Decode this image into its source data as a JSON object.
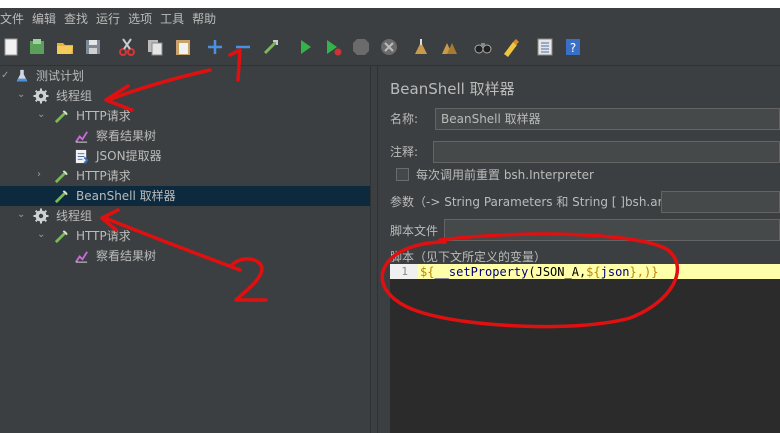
{
  "menu": [
    "文件",
    "编辑",
    "查找",
    "运行",
    "选项",
    "工具",
    "帮助"
  ],
  "toolbar": {
    "icons": [
      "new-icon",
      "templates-icon",
      "open-icon",
      "save-icon",
      "cut-icon",
      "copy-icon",
      "paste-icon",
      "expand-icon",
      "collapse-icon",
      "toggle-icon",
      "start-icon",
      "start-no-pause-icon",
      "stop-icon",
      "shutdown-icon",
      "clear-icon",
      "clear-all-icon",
      "search-icon",
      "reset-search-icon",
      "function-helper-icon",
      "help-icon"
    ]
  },
  "tree": {
    "items": [
      {
        "label": "测试计划",
        "icon": "test-plan-icon"
      },
      {
        "label": "线程组",
        "icon": "thread-group-icon"
      },
      {
        "label": "HTTP请求",
        "icon": "sampler-icon"
      },
      {
        "label": "察看结果树",
        "icon": "listener-icon"
      },
      {
        "label": "JSON提取器",
        "icon": "extractor-icon"
      },
      {
        "label": "HTTP请求",
        "icon": "sampler-icon"
      },
      {
        "label": "BeanShell 取样器",
        "icon": "sampler-icon"
      },
      {
        "label": "线程组",
        "icon": "thread-group-icon"
      },
      {
        "label": "HTTP请求",
        "icon": "sampler-icon"
      },
      {
        "label": "察看结果树",
        "icon": "listener-icon"
      }
    ]
  },
  "panel": {
    "title": "BeanShell 取样器",
    "name_label": "名称:",
    "name_value": "BeanShell 取样器",
    "comment_label": "注释:",
    "comment_value": "",
    "reset_checkbox_label": "每次调用前重置 bsh.Interpreter",
    "reset_checked": false,
    "params_label": "参数（-> String Parameters 和 String [ ]bsh.args）",
    "script_file_label": "脚本文件",
    "script_label": "脚本（见下文所定义的变量）",
    "line_number": "1",
    "code_parts": {
      "p1": "${",
      "p2": "__setProperty",
      "p3": "(JSON_A,",
      "p4": "${",
      "p5": "json",
      "p6": "},)}"
    }
  },
  "annotations": {
    "label_1": "1",
    "label_2": "2",
    "color": "#e01010"
  },
  "colors": {
    "background": "#3c3f41",
    "selected_row": "#0d293e",
    "code_highlight": "#ffffaa",
    "code_brace": "#b8860b",
    "code_fn": "#000080"
  }
}
